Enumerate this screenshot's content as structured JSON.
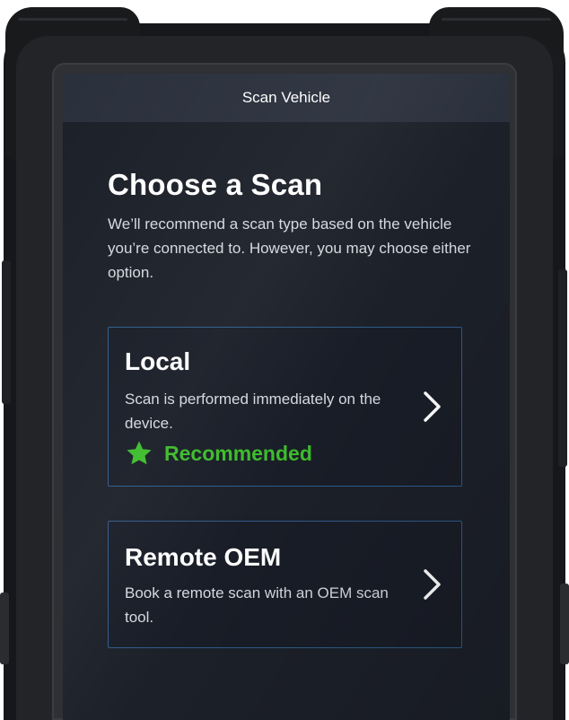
{
  "header": {
    "title": "Scan Vehicle"
  },
  "main": {
    "heading": "Choose a Scan",
    "intro": "We’ll recommend a scan type based on the vehicle you’re connected to. However, you may choose either option."
  },
  "options": [
    {
      "title": "Local",
      "description": "Scan is performed immediately on the device.",
      "badge_label": "Recommended",
      "badge_icon": "star-icon",
      "action_icon": "chevron-right-icon"
    },
    {
      "title": "Remote OEM",
      "description": "Book a remote scan with an OEM scan tool.",
      "action_icon": "chevron-right-icon"
    }
  ],
  "colors": {
    "screen_background": "#1c2029",
    "header_background": "#2a303c",
    "card_border": "#2e5b8a",
    "recommended_green": "#3dbb2c",
    "device_housing": "#16171a"
  }
}
